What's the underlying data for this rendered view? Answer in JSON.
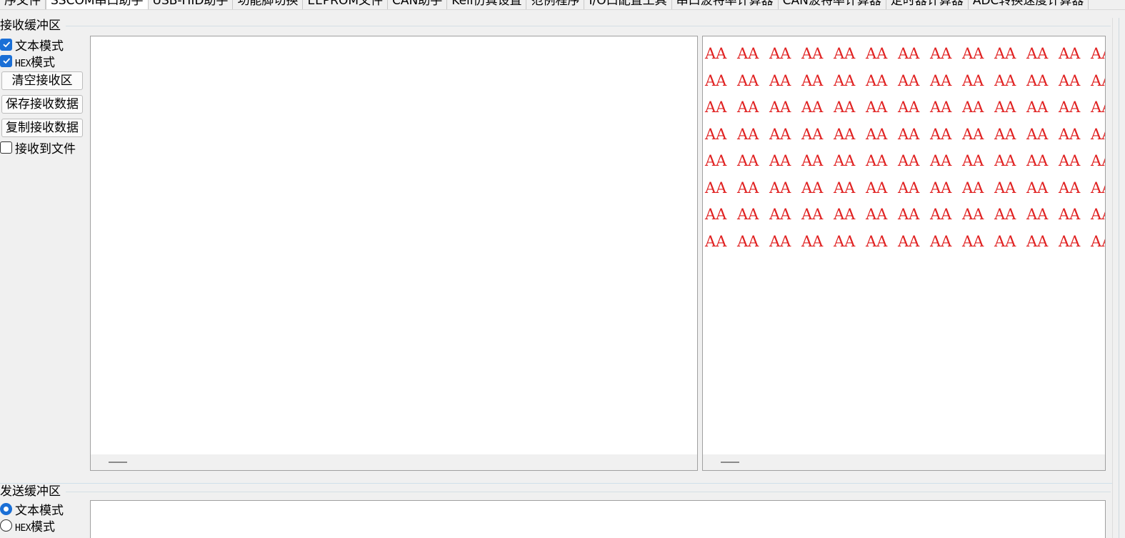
{
  "tabs": [
    {
      "label": "序文件"
    },
    {
      "label": "SSCOM串口助手"
    },
    {
      "label": "USB-HID助手"
    },
    {
      "label": "功能脚切换"
    },
    {
      "label": "EEPROM文件"
    },
    {
      "label": "CAN助手"
    },
    {
      "label": "Keil仿真设置"
    },
    {
      "label": "范例程序"
    },
    {
      "label": "I/O口配置工具"
    },
    {
      "label": "串口波特率计算器"
    },
    {
      "label": "CAN波特率计算器"
    },
    {
      "label": "定时器计算器"
    },
    {
      "label": "ADC转换速度计算器"
    }
  ],
  "receive": {
    "group_title": "接收缓冲区",
    "text_mode_label": "文本模式",
    "text_mode_checked": true,
    "hex_mode_label": "HEX模式",
    "hex_mode_checked": true,
    "clear_label": "清空接收区",
    "save_label": "保存接收数据",
    "copy_label": "复制接收数据",
    "to_file_label": "接收到文件",
    "to_file_checked": false,
    "hex_rows": 8,
    "hex_cols": 13,
    "hex_token": "AA",
    "hex_color": "#e02020"
  },
  "send": {
    "group_title": "发送缓冲区",
    "text_mode_label": "文本模式",
    "text_mode_selected": true,
    "hex_mode_label": "HEX模式",
    "hex_mode_selected": false
  }
}
